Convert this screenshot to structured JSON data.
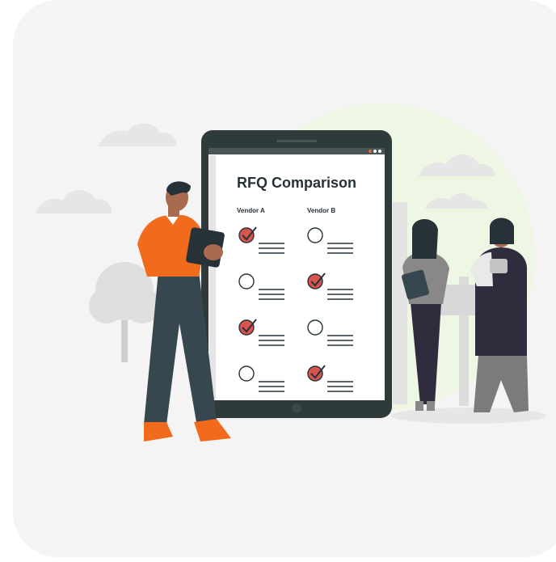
{
  "document": {
    "title": "RFQ Comparison",
    "columns": [
      "Vendor A",
      "Vendor B"
    ]
  },
  "rows": [
    {
      "vendor_a_checked": true,
      "vendor_b_checked": false
    },
    {
      "vendor_a_checked": false,
      "vendor_b_checked": true
    },
    {
      "vendor_a_checked": true,
      "vendor_b_checked": false
    },
    {
      "vendor_a_checked": false,
      "vendor_b_checked": true
    }
  ],
  "colors": {
    "background": "#f4f4f4",
    "accent": "#d9534f",
    "tablet_frame": "#2f3a3a",
    "shirt": "#f26b1d",
    "shade": "#e8e8e8",
    "green_circle": "#eef7df"
  },
  "icons": [
    "tablet-icon",
    "person-icon",
    "tree-icon",
    "cloud-icon",
    "checkmark-icon"
  ]
}
